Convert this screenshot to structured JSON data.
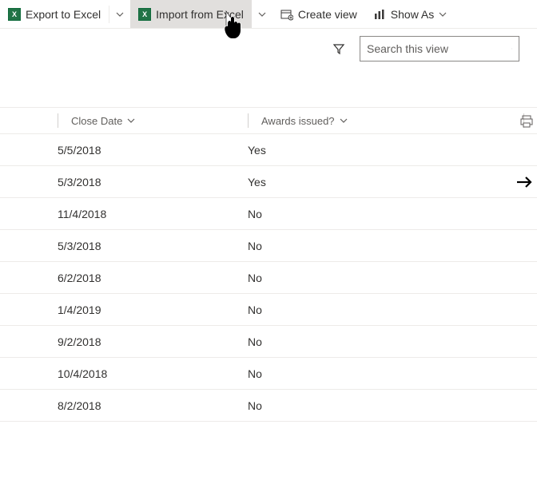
{
  "toolbar": {
    "export_label": "Export to Excel",
    "import_label": "Import from Excel",
    "create_view_label": "Create view",
    "show_as_label": "Show As"
  },
  "search": {
    "placeholder": "Search this view"
  },
  "columns": {
    "close_date": "Close Date",
    "awards_issued": "Awards issued?"
  },
  "rows": [
    {
      "close_date": "5/5/2018",
      "awards": "Yes",
      "hasArrow": false
    },
    {
      "close_date": "5/3/2018",
      "awards": "Yes",
      "hasArrow": true
    },
    {
      "close_date": "11/4/2018",
      "awards": "No",
      "hasArrow": false
    },
    {
      "close_date": "5/3/2018",
      "awards": "No",
      "hasArrow": false
    },
    {
      "close_date": "6/2/2018",
      "awards": "No",
      "hasArrow": false
    },
    {
      "close_date": "1/4/2019",
      "awards": "No",
      "hasArrow": false
    },
    {
      "close_date": "9/2/2018",
      "awards": "No",
      "hasArrow": false
    },
    {
      "close_date": "10/4/2018",
      "awards": "No",
      "hasArrow": false
    },
    {
      "close_date": "8/2/2018",
      "awards": "No",
      "hasArrow": false
    }
  ]
}
